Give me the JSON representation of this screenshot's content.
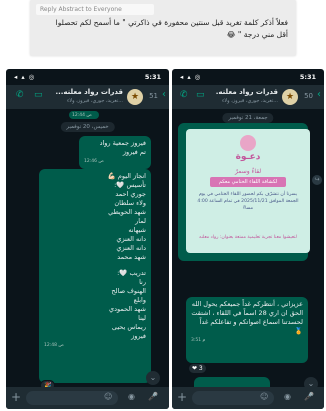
{
  "top_card": {
    "reply_label": "Reply Abstract to Everyone",
    "message": "فعلاً أذكر كلمة تغريد قبل سنتين محفورة في ذاكرتي \" ما أسمح لكم تحصلوا أقل مني درجة \" 😂"
  },
  "left_phone": {
    "status": {
      "time": "5:31",
      "sys": "◂ ▴ ◎"
    },
    "header": {
      "title": "قدرات رواد معلنه...",
      "subtitle": "...تغريد، جوري، فيروز، ولاء",
      "count": "51",
      "back": "‹"
    },
    "messages": {
      "first_in_ts": "12:44 ص",
      "date_chip": "خميس، 20 نوفمبر",
      "out_1": "فيروز جمعية رواد",
      "out_1b": "تم فيروز",
      "out_1_ts": "12:46 ص",
      "list_title": "انجاز اليوم 💪🏻",
      "list_items": [
        "تأسيس 🤍:",
        "جوري احمد",
        "ولاء سلطان",
        "شهد الحويطي",
        "لمار",
        "شيهانه",
        "دانه العنزي",
        "دانه العنزي",
        "شهد محمد"
      ],
      "list2_title": "تدريب 🤍:",
      "list2_items": [
        "رنا",
        "الهنوف صالح",
        "وابلع",
        "شهد الحمودي",
        "لينا",
        "ريماس يحيى",
        "فيروز"
      ],
      "list_ts": "12:48 ص",
      "reaction": "🎉",
      "down": "⌄"
    },
    "input": {
      "plus": "+",
      "sticker": "☺",
      "camera": "◉",
      "mic": "🎤"
    }
  },
  "right_phone": {
    "status": {
      "time": "5:31",
      "sys": "◂ ▴ ◎"
    },
    "header": {
      "title": "قدرات رواد معلنه...",
      "subtitle": "...تغريد، جوري، فيروز، ولاء",
      "count": "50",
      "back": "‹"
    },
    "messages": {
      "date_chip": "جمعة، 21 نوفمبر",
      "invite": {
        "title": "دعـوة",
        "subtitle": "لقاءٌ وسمرٌ",
        "banner": "لكشافة اللقاء الختامي معكم",
        "body": "يسرنا أن نتشرّف بكم لحضور اللقاء الختامي في يوم الجمعة الموافق 2025/11/21 في تمام الساعة 4:00 مساءً",
        "footer": "لتعيشوا معنا تجربة تعليمية ممتعة بعنوان: رواد معلنه"
      },
      "share": "↪",
      "out_text": "عزيزاتي ، أنتظركم غداً جميعكم يحول الله الحق ان اري 28 اسماً في اللقاء ، اشتقت لحسدتنا اسماع اصواتكم و تفاعلكم غداً 🏅",
      "out_ts": "3:51 م",
      "reaction": "❤ 3",
      "down": "⌄"
    },
    "input": {
      "plus": "+",
      "sticker": "☺",
      "camera": "◉",
      "mic": "🎤"
    }
  }
}
